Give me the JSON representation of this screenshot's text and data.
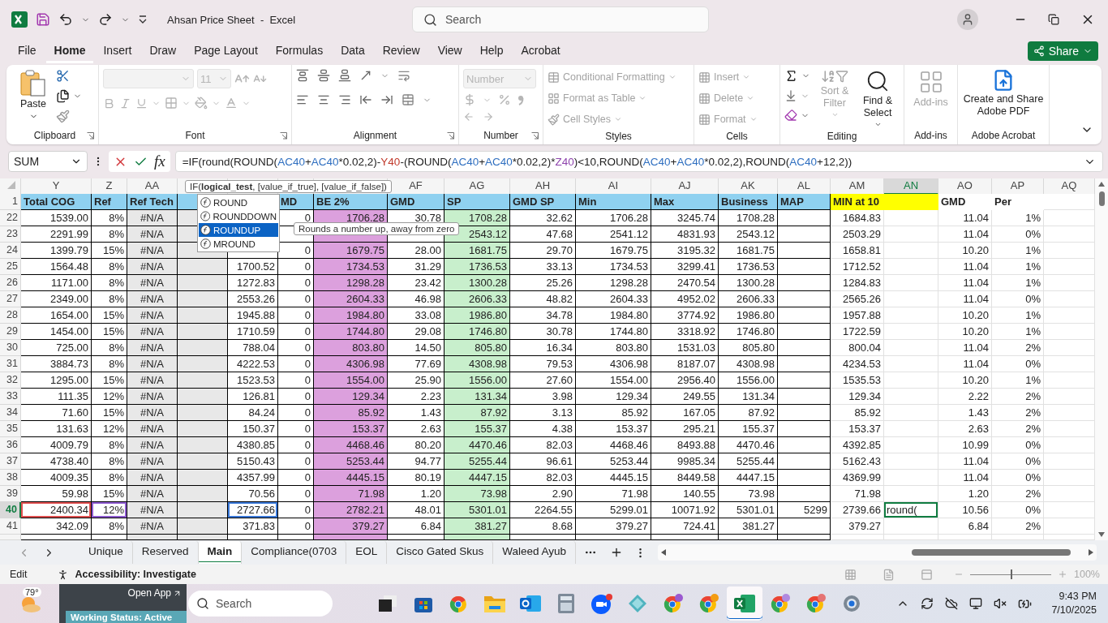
{
  "title_bar": {
    "title": "Ahsan Price Sheet  -  Excel",
    "search": {
      "placeholder": "Search"
    }
  },
  "menu": [
    {
      "label": "File",
      "selected": false
    },
    {
      "label": "Home",
      "selected": true
    },
    {
      "label": "Insert",
      "selected": false
    },
    {
      "label": "Draw",
      "selected": false
    },
    {
      "label": "Page Layout",
      "selected": false
    },
    {
      "label": "Formulas",
      "selected": false
    },
    {
      "label": "Data",
      "selected": false
    },
    {
      "label": "Review",
      "selected": false
    },
    {
      "label": "View",
      "selected": false
    },
    {
      "label": "Help",
      "selected": false
    },
    {
      "label": "Acrobat",
      "selected": false
    }
  ],
  "share": {
    "label": "Share"
  },
  "ribbon": {
    "clipboard": {
      "label": "Clipboard",
      "paste": "Paste"
    },
    "font": {
      "label": "Font",
      "size": "11",
      "disabled": true
    },
    "alignment": {
      "label": "Alignment"
    },
    "number": {
      "label": "Number",
      "format": "Number",
      "disabled": true
    },
    "styles": {
      "label": "Styles",
      "items": [
        {
          "label": "Conditional Formatting",
          "disabled": true
        },
        {
          "label": "Format as Table",
          "disabled": true
        },
        {
          "label": "Cell Styles",
          "disabled": true
        }
      ]
    },
    "cells": {
      "label": "Cells",
      "items": [
        {
          "label": "Insert",
          "disabled": true
        },
        {
          "label": "Delete",
          "disabled": true
        },
        {
          "label": "Format",
          "disabled": true
        }
      ]
    },
    "editing": {
      "label": "Editing",
      "sort": {
        "label": "Sort & Filter",
        "disabled": true
      },
      "find": {
        "label": "Find & Select",
        "disabled": false
      }
    },
    "addins": {
      "label": "Add-ins",
      "button": {
        "label": "Add-ins",
        "disabled": true
      }
    },
    "acrobat": {
      "label": "Adobe Acrobat",
      "button": {
        "label": "Create and Share Adobe PDF"
      }
    }
  },
  "formula_bar": {
    "name_box": "SUM",
    "function_button": "fx",
    "segments": [
      {
        "text": "=IF(round(ROUND(",
        "color": "#222222"
      },
      {
        "text": "AC40",
        "color": "#2f6fc0"
      },
      {
        "text": "+",
        "color": "#222222"
      },
      {
        "text": "AC40",
        "color": "#2f6fc0"
      },
      {
        "text": "*0.02,2)-",
        "color": "#222222"
      },
      {
        "text": "Y40",
        "color": "#c0392b"
      },
      {
        "text": "-(ROUND(",
        "color": "#222222"
      },
      {
        "text": "AC40",
        "color": "#2f6fc0"
      },
      {
        "text": "+",
        "color": "#222222"
      },
      {
        "text": "AC40",
        "color": "#2f6fc0"
      },
      {
        "text": "*0.02,2)*",
        "color": "#222222"
      },
      {
        "text": "Z40",
        "color": "#8e44ad"
      },
      {
        "text": ")<10,ROUND(",
        "color": "#222222"
      },
      {
        "text": "AC40",
        "color": "#2f6fc0"
      },
      {
        "text": "+",
        "color": "#222222"
      },
      {
        "text": "AC40",
        "color": "#2f6fc0"
      },
      {
        "text": "*0.02,2),ROUND(",
        "color": "#222222"
      },
      {
        "text": "AC40",
        "color": "#2f6fc0"
      },
      {
        "text": "+12,2))",
        "color": "#222222"
      }
    ]
  },
  "grid": {
    "columns": [
      {
        "label": "Y",
        "selected": false
      },
      {
        "label": "Z",
        "selected": false
      },
      {
        "label": "AA",
        "selected": false
      },
      {
        "selected": false
      },
      {
        "selected": false
      },
      {
        "selected": false
      },
      {
        "selected": false
      },
      {
        "label": "AF",
        "selected": false
      },
      {
        "label": "AG",
        "selected": false
      },
      {
        "label": "AH",
        "selected": false
      },
      {
        "label": "AI",
        "selected": false
      },
      {
        "label": "AJ",
        "selected": false
      },
      {
        "label": "AK",
        "selected": false
      },
      {
        "label": "AL",
        "selected": false
      },
      {
        "label": "AM",
        "selected": false
      },
      {
        "label": "AN",
        "selected": true
      },
      {
        "label": "AO",
        "selected": false
      },
      {
        "label": "AP",
        "selected": false
      },
      {
        "label": "AQ",
        "selected": false
      }
    ],
    "header_row": {
      "number": "1",
      "selected": false,
      "cells": [
        {
          "text": "Total COG",
          "color": "#8fd1f0"
        },
        {
          "text": "Ref",
          "color": "#8fd1f0"
        },
        {
          "text": "Ref Tech",
          "color": "#8fd1f0"
        },
        {
          "color": "#8fd1f0"
        },
        null,
        {
          "text": "MD",
          "color": "#8fd1f0"
        },
        {
          "text": "BE 2%",
          "color": "#8fd1f0"
        },
        {
          "text": "GMD",
          "color": "#8fd1f0"
        },
        {
          "text": "SP",
          "color": "#8fd1f0"
        },
        {
          "text": "GMD SP",
          "color": "#8fd1f0"
        },
        {
          "text": "Min",
          "color": "#8fd1f0"
        },
        {
          "text": "Max",
          "color": "#8fd1f0"
        },
        {
          "text": "Business",
          "color": "#8fd1f0"
        },
        {
          "text": "MAP",
          "color": "#8fd1f0"
        },
        {
          "text": "MIN at 10",
          "color": "#ffff00"
        },
        {
          "color": "#ffff00"
        },
        {
          "text": "GMD",
          "color": "#ffffff"
        },
        {
          "text": "Per",
          "color": "#ffffff"
        }
      ]
    },
    "rows": [
      {
        "number": "22",
        "selected": false,
        "cells": [
          "1539.00",
          "8%",
          "#N/A",
          null,
          null,
          "0",
          "1706.28",
          "30.78",
          "1708.28",
          "32.62",
          "1706.28",
          "3245.74",
          "1708.28",
          null,
          "1684.83",
          null,
          "11.04",
          "1%"
        ]
      },
      {
        "number": "23",
        "selected": false,
        "cells": [
          "2291.99",
          "8%",
          "#N/A",
          null,
          null,
          null,
          null,
          null,
          "2543.12",
          "47.68",
          "2541.12",
          "4831.93",
          "2543.12",
          null,
          "2503.29",
          null,
          "11.04",
          "0%"
        ]
      },
      {
        "number": "24",
        "selected": false,
        "cells": [
          "1399.79",
          "15%",
          "#N/A",
          null,
          null,
          "0",
          "1679.75",
          "28.00",
          "1681.75",
          "29.70",
          "1679.75",
          "3195.32",
          "1681.75",
          null,
          "1658.81",
          null,
          "10.20",
          "1%"
        ]
      },
      {
        "number": "25",
        "selected": false,
        "cells": [
          "1564.48",
          "8%",
          "#N/A",
          null,
          "1700.52",
          "0",
          "1734.53",
          "31.29",
          "1736.53",
          "33.13",
          "1734.53",
          "3299.41",
          "1736.53",
          null,
          "1712.52",
          null,
          "11.04",
          "1%"
        ]
      },
      {
        "number": "26",
        "selected": false,
        "cells": [
          "1171.00",
          "8%",
          "#N/A",
          null,
          "1272.83",
          "0",
          "1298.28",
          "23.42",
          "1300.28",
          "25.26",
          "1298.28",
          "2470.54",
          "1300.28",
          null,
          "1284.83",
          null,
          "11.04",
          "1%"
        ]
      },
      {
        "number": "27",
        "selected": false,
        "cells": [
          "2349.00",
          "8%",
          "#N/A",
          null,
          "2553.26",
          "0",
          "2604.33",
          "46.98",
          "2606.33",
          "48.82",
          "2604.33",
          "4952.02",
          "2606.33",
          null,
          "2565.26",
          null,
          "11.04",
          "0%"
        ]
      },
      {
        "number": "28",
        "selected": false,
        "cells": [
          "1654.00",
          "15%",
          "#N/A",
          null,
          "1945.88",
          "0",
          "1984.80",
          "33.08",
          "1986.80",
          "34.78",
          "1984.80",
          "3774.92",
          "1986.80",
          null,
          "1957.88",
          null,
          "10.20",
          "1%"
        ]
      },
      {
        "number": "29",
        "selected": false,
        "cells": [
          "1454.00",
          "15%",
          "#N/A",
          null,
          "1710.59",
          "0",
          "1744.80",
          "29.08",
          "1746.80",
          "30.78",
          "1744.80",
          "3318.92",
          "1746.80",
          null,
          "1722.59",
          null,
          "10.20",
          "1%"
        ]
      },
      {
        "number": "30",
        "selected": false,
        "cells": [
          "725.00",
          "8%",
          "#N/A",
          null,
          "788.04",
          "0",
          "803.80",
          "14.50",
          "805.80",
          "16.34",
          "803.80",
          "1531.03",
          "805.80",
          null,
          "800.04",
          null,
          "11.04",
          "2%"
        ]
      },
      {
        "number": "31",
        "selected": false,
        "cells": [
          "3884.73",
          "8%",
          "#N/A",
          null,
          "4222.53",
          "0",
          "4306.98",
          "77.69",
          "4308.98",
          "79.53",
          "4306.98",
          "8187.07",
          "4308.98",
          null,
          "4234.53",
          null,
          "11.04",
          "0%"
        ]
      },
      {
        "number": "32",
        "selected": false,
        "cells": [
          "1295.00",
          "15%",
          "#N/A",
          null,
          "1523.53",
          "0",
          "1554.00",
          "25.90",
          "1556.00",
          "27.60",
          "1554.00",
          "2956.40",
          "1556.00",
          null,
          "1535.53",
          null,
          "10.20",
          "1%"
        ]
      },
      {
        "number": "33",
        "selected": false,
        "cells": [
          "111.35",
          "12%",
          "#N/A",
          null,
          "126.81",
          "0",
          "129.34",
          "2.23",
          "131.34",
          "3.98",
          "129.34",
          "249.55",
          "131.34",
          null,
          "129.34",
          null,
          "2.22",
          "2%"
        ]
      },
      {
        "number": "34",
        "selected": false,
        "cells": [
          "71.60",
          "15%",
          "#N/A",
          null,
          "84.24",
          "0",
          "85.92",
          "1.43",
          "87.92",
          "3.13",
          "85.92",
          "167.05",
          "87.92",
          null,
          "85.92",
          null,
          "1.43",
          "2%"
        ]
      },
      {
        "number": "35",
        "selected": false,
        "cells": [
          "131.63",
          "12%",
          "#N/A",
          null,
          "150.37",
          "0",
          "153.37",
          "2.63",
          "155.37",
          "4.38",
          "153.37",
          "295.21",
          "155.37",
          null,
          "153.37",
          null,
          "2.63",
          "2%"
        ]
      },
      {
        "number": "36",
        "selected": false,
        "cells": [
          "4009.79",
          "8%",
          "#N/A",
          null,
          "4380.85",
          "0",
          "4468.46",
          "80.20",
          "4470.46",
          "82.03",
          "4468.46",
          "8493.88",
          "4470.46",
          null,
          "4392.85",
          null,
          "10.99",
          "0%"
        ]
      },
      {
        "number": "37",
        "selected": false,
        "cells": [
          "4738.40",
          "8%",
          "#N/A",
          null,
          "5150.43",
          "0",
          "5253.44",
          "94.77",
          "5255.44",
          "96.61",
          "5253.44",
          "9985.34",
          "5255.44",
          null,
          "5162.43",
          null,
          "11.04",
          "0%"
        ]
      },
      {
        "number": "38",
        "selected": false,
        "cells": [
          "4009.35",
          "8%",
          "#N/A",
          null,
          "4357.99",
          "0",
          "4445.15",
          "80.19",
          "4447.15",
          "82.03",
          "4445.15",
          "8449.58",
          "4447.15",
          null,
          "4369.99",
          null,
          "11.04",
          "0%"
        ]
      },
      {
        "number": "39",
        "selected": false,
        "cells": [
          "59.98",
          "15%",
          "#N/A",
          null,
          "70.56",
          "0",
          "71.98",
          "1.20",
          "73.98",
          "2.90",
          "71.98",
          "140.55",
          "73.98",
          null,
          "71.98",
          null,
          "1.20",
          "2%"
        ]
      },
      {
        "number": "40",
        "selected": true,
        "cells": [
          {
            "text": "2400.34",
            "color": "#e05050"
          },
          {
            "text": "12%",
            "color": "#8e5bd0"
          },
          "#N/A",
          null,
          {
            "text": "2727.66",
            "color": "#3a78d8"
          },
          "0",
          "2782.21",
          "48.01",
          "5301.01",
          "2264.55",
          "5299.01",
          "10071.92",
          "5301.01",
          "5299",
          "2739.66",
          "round(",
          "10.56",
          "0%"
        ]
      },
      {
        "number": "41",
        "selected": false,
        "cells": [
          "342.09",
          "8%",
          "#N/A",
          null,
          "371.83",
          "0",
          "379.27",
          "6.84",
          "381.27",
          "8.68",
          "379.27",
          "724.41",
          "381.27",
          null,
          "379.27",
          null,
          "6.84",
          "2%"
        ]
      }
    ]
  },
  "autocomplete": {
    "signature": "IF(**logical_test**, [value_if_true], [value_if_false])",
    "items": [
      {
        "label": "ROUND",
        "selected": false
      },
      {
        "label": "ROUNDDOWN",
        "selected": false
      },
      {
        "label": "ROUNDUP",
        "selected": true
      },
      {
        "label": "MROUND",
        "selected": false
      }
    ],
    "description": "Rounds a number up, away from zero"
  },
  "sheet_tabs": [
    {
      "label": "Unique",
      "selected": false
    },
    {
      "label": "Reserved",
      "selected": false
    },
    {
      "label": "Main",
      "selected": true
    },
    {
      "label": "Compliance(0703",
      "selected": false
    },
    {
      "label": "EOL",
      "selected": false
    },
    {
      "label": "Cisco Gated Skus",
      "selected": false
    },
    {
      "label": "Waleed Ayub",
      "selected": false
    }
  ],
  "status_bar": {
    "mode": "Edit",
    "accessibility": "Accessibility: Investigate",
    "zoom": {
      "level": 0.5,
      "reading": "100%"
    }
  },
  "taskbar": {
    "weather": "79°",
    "widget": {
      "button": "Open App",
      "status": "Working Status: Active"
    },
    "search": {
      "placeholder": "Search"
    },
    "apps": [
      {
        "selected": false
      },
      {
        "selected": false
      },
      {
        "selected": false
      },
      {
        "selected": false
      },
      {
        "selected": false
      },
      {
        "selected": false
      },
      {
        "selected": false
      },
      {
        "selected": false
      },
      {
        "selected": false
      },
      {
        "selected": false
      },
      {
        "selected": true
      },
      {
        "selected": false
      },
      {
        "selected": false
      },
      {
        "selected": false
      }
    ],
    "time": "9:43 PM",
    "date": "7/10/2025"
  }
}
